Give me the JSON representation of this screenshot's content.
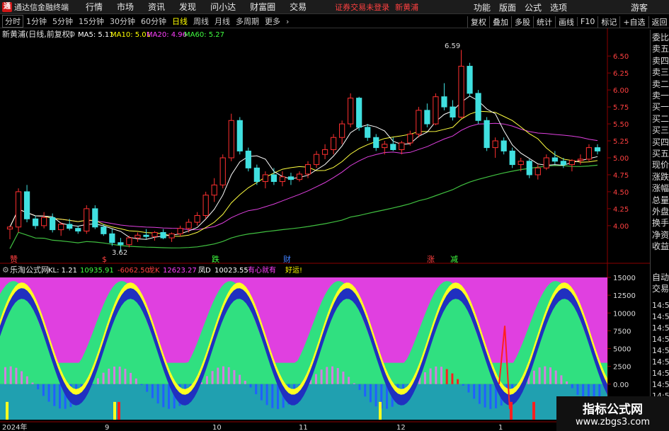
{
  "titlebar": {
    "app_title": "通达信金融终端",
    "menus": [
      "行情",
      "市场",
      "资讯",
      "发现",
      "问小达",
      "财富圈",
      "交易"
    ],
    "login_warning": "证券交易未登录",
    "stock_name": "新黄浦",
    "right_menus": [
      "功能",
      "版面",
      "公式",
      "选项"
    ],
    "guest": "游客"
  },
  "toolbar": {
    "periods": [
      "分时",
      "1分钟",
      "5分钟",
      "15分钟",
      "30分钟",
      "60分钟",
      "日线",
      "周线",
      "月线",
      "多周期",
      "更多"
    ],
    "active_period": "日线",
    "tools": [
      "复权",
      "叠加",
      "多股",
      "统计",
      "画线",
      "F10",
      "标记",
      "+自选",
      "返回"
    ]
  },
  "price_pane": {
    "header": "新黄浦(日线,前复权)",
    "ma5": "MA5: 5.11",
    "ma10": "MA10: 5.01",
    "ma20": "MA20: 4.96",
    "ma60": "MA60: 5.27",
    "high_label": "6.59",
    "low_label": "3.62",
    "axis_ticks": [
      "6.50",
      "6.25",
      "6.00",
      "5.75",
      "5.50",
      "5.25",
      "5.00",
      "4.75",
      "4.50",
      "4.25",
      "4.00"
    ],
    "signals": [
      {
        "text": "赞",
        "color": "#ff4040"
      },
      {
        "text": "$",
        "color": "#ff4040"
      },
      {
        "text": "跌",
        "color": "#40ff40"
      },
      {
        "text": "财",
        "color": "#4080ff"
      },
      {
        "text": "涨",
        "color": "#ff4040"
      },
      {
        "text": "减",
        "color": "#40ff40"
      }
    ]
  },
  "indicator_pane": {
    "name": "乐淘公式网",
    "kl": "KL: 1.21",
    "v1": "10935.91",
    "v2": "-6062.50",
    "v3_label": "龙K",
    "v3": "12623.27",
    "v4_label": "凤D",
    "v4": "10023.55",
    "slogan": "有心就有",
    "slogan2": "好运!",
    "axis_ticks": [
      "15000",
      "12500",
      "10000",
      "7500",
      "5000",
      "2500",
      "0.00",
      "-2500"
    ]
  },
  "time_axis": [
    "2024年",
    "9",
    "10",
    "11",
    "12",
    "1"
  ],
  "side_panel": {
    "items": [
      "委比",
      "卖五",
      "卖四",
      "卖三",
      "卖二",
      "卖一",
      "买一",
      "买二",
      "买三",
      "买四",
      "买五",
      "现价",
      "涨跌",
      "涨幅",
      "总量",
      "外盘",
      "换手",
      "净资",
      "收益"
    ],
    "bottom_items": [
      "自动",
      "交易"
    ],
    "times": [
      "14:56",
      "14:56",
      "14:56",
      "14:56",
      "14:56",
      "14:56",
      "14:56",
      "14:56",
      "14:56"
    ]
  },
  "watermark": {
    "title": "指标公式网",
    "url": "www.zbgs3.com"
  },
  "chart_data": {
    "type": "candlestick",
    "price_range": [
      3.55,
      6.7
    ],
    "indicator_range": [
      -5000,
      15000
    ],
    "candles": [
      [
        3.95,
        4.0,
        3.8,
        3.98
      ],
      [
        3.98,
        4.55,
        3.9,
        4.5
      ],
      [
        4.5,
        4.6,
        4.05,
        4.1
      ],
      [
        4.1,
        4.15,
        3.95,
        4.0
      ],
      [
        4.0,
        4.2,
        3.96,
        4.12
      ],
      [
        4.12,
        4.18,
        3.9,
        3.94
      ],
      [
        3.94,
        4.05,
        3.85,
        4.02
      ],
      [
        4.02,
        4.1,
        3.93,
        3.96
      ],
      [
        3.96,
        4.0,
        3.88,
        3.92
      ],
      [
        3.92,
        4.3,
        3.88,
        4.25
      ],
      [
        4.25,
        4.3,
        3.95,
        3.98
      ],
      [
        3.98,
        4.02,
        3.85,
        3.88
      ],
      [
        3.88,
        3.95,
        3.7,
        3.75
      ],
      [
        3.75,
        3.82,
        3.62,
        3.72
      ],
      [
        3.72,
        3.85,
        3.68,
        3.82
      ],
      [
        3.82,
        3.9,
        3.76,
        3.86
      ],
      [
        3.86,
        3.95,
        3.8,
        3.84
      ],
      [
        3.84,
        3.92,
        3.78,
        3.9
      ],
      [
        3.9,
        3.95,
        3.8,
        3.82
      ],
      [
        3.82,
        3.9,
        3.76,
        3.88
      ],
      [
        3.88,
        4.0,
        3.84,
        3.96
      ],
      [
        3.96,
        4.1,
        3.9,
        4.05
      ],
      [
        4.05,
        4.2,
        4.0,
        4.15
      ],
      [
        4.15,
        4.5,
        4.1,
        4.45
      ],
      [
        4.45,
        4.7,
        4.35,
        4.6
      ],
      [
        4.6,
        5.05,
        4.55,
        5.0
      ],
      [
        5.0,
        5.65,
        4.95,
        5.55
      ],
      [
        5.55,
        5.6,
        5.05,
        5.1
      ],
      [
        5.1,
        5.15,
        4.8,
        4.85
      ],
      [
        4.85,
        4.9,
        4.6,
        4.65
      ],
      [
        4.65,
        4.8,
        4.55,
        4.75
      ],
      [
        4.75,
        4.85,
        4.6,
        4.65
      ],
      [
        4.65,
        4.8,
        4.58,
        4.72
      ],
      [
        4.72,
        4.78,
        4.6,
        4.68
      ],
      [
        4.68,
        4.8,
        4.65,
        4.76
      ],
      [
        4.76,
        4.95,
        4.7,
        4.9
      ],
      [
        4.9,
        5.1,
        4.85,
        5.05
      ],
      [
        5.05,
        5.2,
        4.98,
        5.12
      ],
      [
        5.12,
        5.35,
        5.05,
        5.3
      ],
      [
        5.3,
        5.55,
        5.2,
        5.5
      ],
      [
        5.5,
        5.95,
        5.45,
        5.88
      ],
      [
        5.88,
        5.9,
        5.4,
        5.45
      ],
      [
        5.45,
        5.5,
        5.25,
        5.3
      ],
      [
        5.3,
        5.35,
        5.1,
        5.15
      ],
      [
        5.15,
        5.25,
        5.05,
        5.2
      ],
      [
        5.2,
        5.3,
        5.1,
        5.12
      ],
      [
        5.12,
        5.25,
        5.05,
        5.22
      ],
      [
        5.22,
        5.4,
        5.18,
        5.35
      ],
      [
        5.35,
        5.75,
        5.3,
        5.7
      ],
      [
        5.7,
        5.8,
        5.45,
        5.5
      ],
      [
        5.5,
        5.95,
        5.48,
        5.9
      ],
      [
        5.9,
        6.1,
        5.7,
        5.75
      ],
      [
        5.75,
        5.85,
        5.55,
        5.6
      ],
      [
        5.6,
        6.59,
        5.58,
        6.35
      ],
      [
        6.35,
        6.4,
        5.9,
        5.95
      ],
      [
        5.95,
        6.0,
        5.5,
        5.55
      ],
      [
        5.55,
        5.6,
        5.1,
        5.15
      ],
      [
        5.15,
        5.3,
        5.0,
        5.25
      ],
      [
        5.25,
        5.3,
        5.05,
        5.1
      ],
      [
        5.1,
        5.15,
        4.85,
        4.9
      ],
      [
        4.9,
        5.0,
        4.8,
        4.95
      ],
      [
        4.95,
        4.98,
        4.7,
        4.75
      ],
      [
        4.75,
        4.9,
        4.68,
        4.85
      ],
      [
        4.85,
        5.05,
        4.82,
        5.0
      ],
      [
        5.0,
        5.1,
        4.9,
        4.95
      ],
      [
        4.95,
        5.0,
        4.85,
        4.9
      ],
      [
        4.9,
        4.98,
        4.8,
        4.96
      ],
      [
        4.96,
        5.05,
        4.9,
        4.98
      ],
      [
        4.98,
        5.2,
        4.95,
        5.15
      ],
      [
        5.15,
        5.2,
        5.05,
        5.1
      ]
    ]
  }
}
